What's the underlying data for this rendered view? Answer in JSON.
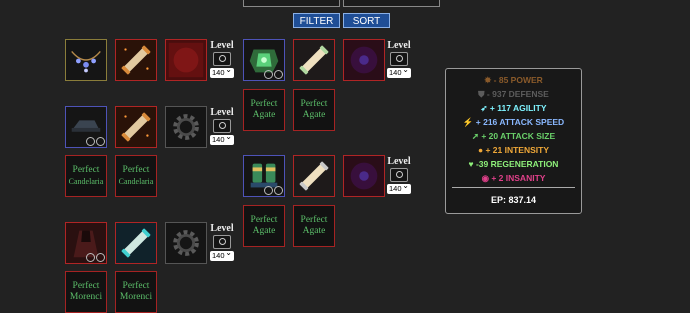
{
  "toolbar": {
    "filter_label": "FILTER",
    "sort_label": "SORT"
  },
  "level": {
    "label": "Level",
    "value": "140"
  },
  "gems": {
    "agate_1": {
      "quality": "Perfect",
      "name": "Agate"
    },
    "agate_2": {
      "quality": "Perfect",
      "name": "Agate"
    },
    "agate_3": {
      "quality": "Perfect",
      "name": "Agate"
    },
    "agate_4": {
      "quality": "Perfect",
      "name": "Agate"
    },
    "candelaria_1": {
      "quality": "Perfect",
      "name": "Candelaria"
    },
    "candelaria_2": {
      "quality": "Perfect",
      "name": "Candelaria"
    },
    "morenci_1": {
      "quality": "Perfect",
      "name": "Morenci"
    },
    "morenci_2": {
      "quality": "Perfect",
      "name": "Morenci"
    }
  },
  "stats": {
    "lines": [
      {
        "text": "- 85 POWER",
        "color": "#8a5a2a",
        "icon": "power-icon"
      },
      {
        "text": "- 937 DEFENSE",
        "color": "#5c5c5c",
        "icon": "shield-icon"
      },
      {
        "text": "+ 117 AGILITY",
        "color": "#7ff3ff",
        "icon": "agility-icon"
      },
      {
        "text": "+ 216 ATTACK SPEED",
        "color": "#8ab8ff",
        "icon": "attack-speed-icon"
      },
      {
        "text": "+ 20 ATTACK SIZE",
        "color": "#6ad06a",
        "icon": "attack-size-icon"
      },
      {
        "text": "+ 21 INTENSITY",
        "color": "#f0a838",
        "icon": "intensity-icon"
      },
      {
        "text": "-39 REGENERATION",
        "color": "#8ef07a",
        "icon": "heart-icon"
      },
      {
        "text": "+ 2 INSANITY",
        "color": "#e0408a",
        "icon": "eye-icon"
      }
    ],
    "ep": "EP: 837.14"
  }
}
